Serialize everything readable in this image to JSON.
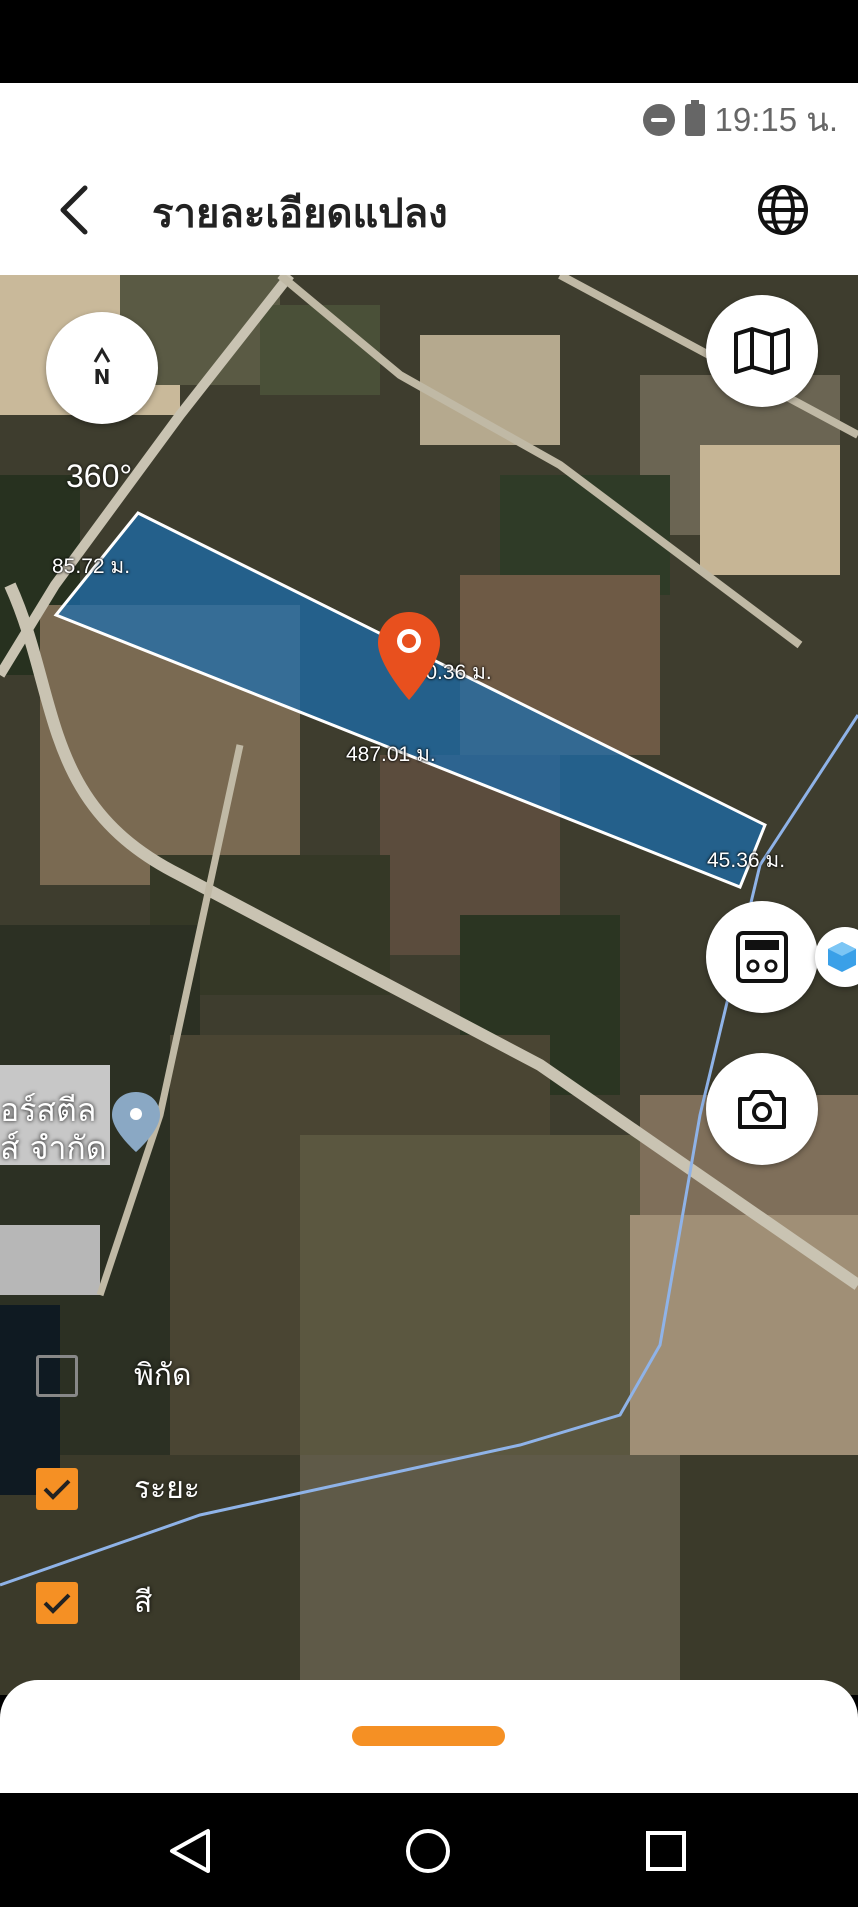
{
  "status_bar": {
    "time": "19:15 น."
  },
  "header": {
    "title": "รายละเอียดแปลง"
  },
  "map": {
    "rotation_label": "360°",
    "compass_label": "N",
    "poi_label_line1": "อร์สตีล",
    "poi_label_line2": "ส์ จำกัด",
    "measurements": {
      "left_edge": "85.72 ม.",
      "top_edge": "460.36 ม.",
      "bottom_edge": "487.01 ม.",
      "right_edge": "45.36 ม."
    },
    "plot_color": "#1a6fb3"
  },
  "layers": [
    {
      "label": "พิกัด",
      "checked": false
    },
    {
      "label": "ระยะ",
      "checked": true
    },
    {
      "label": "สี",
      "checked": true
    }
  ],
  "colors": {
    "accent": "#f59024",
    "pin": "#e8501e"
  }
}
